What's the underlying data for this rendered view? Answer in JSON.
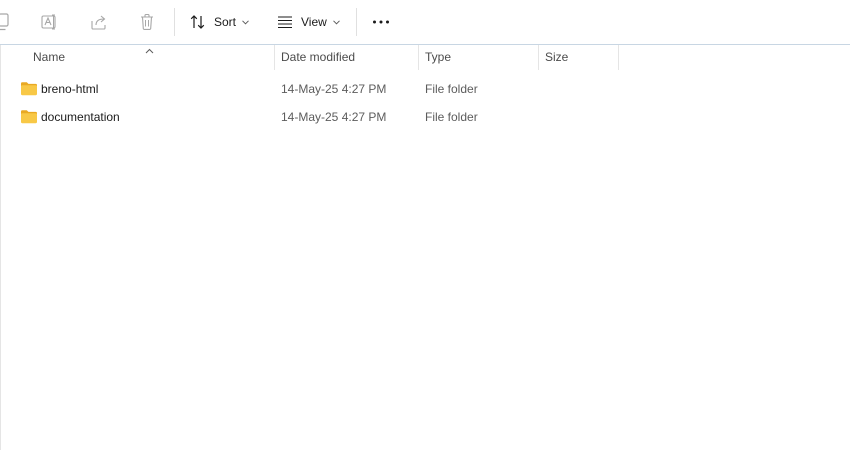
{
  "toolbar": {
    "sort_label": "Sort",
    "view_label": "View",
    "icons": [
      "copy-icon",
      "rename-icon",
      "share-icon",
      "delete-icon",
      "sort-icon",
      "view-icon",
      "more-icon"
    ]
  },
  "columns": {
    "name": "Name",
    "date_modified": "Date modified",
    "type": "Type",
    "size": "Size"
  },
  "files": [
    {
      "name": "breno-html",
      "date_modified": "14-May-25 4:27 PM",
      "type": "File folder",
      "size": "",
      "icon": "folder-icon"
    },
    {
      "name": "documentation",
      "date_modified": "14-May-25 4:27 PM",
      "type": "File folder",
      "size": "",
      "icon": "folder-icon"
    }
  ],
  "colors": {
    "folder": "#f8c846",
    "folder_dark": "#e9a923",
    "header_border": "#c8d6e3",
    "accent": "#0067c0"
  }
}
